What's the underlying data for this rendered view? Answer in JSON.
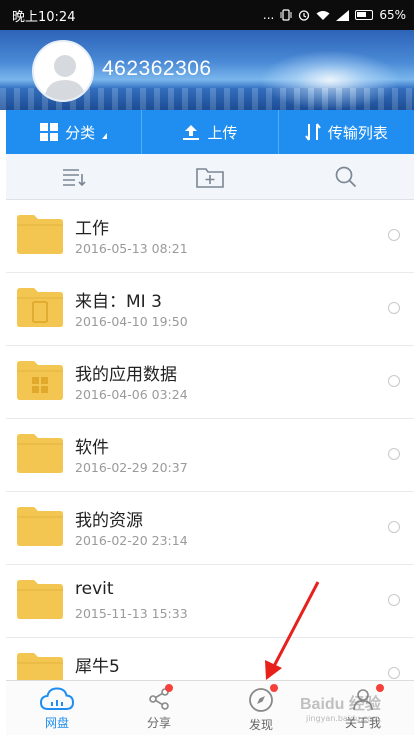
{
  "status_bar": {
    "time": "晚上10:24",
    "signal_dots": "...",
    "battery": "65%"
  },
  "profile": {
    "username": "462362306"
  },
  "actions": {
    "category": "分类",
    "upload": "上传",
    "transfer_list": "传输列表"
  },
  "files": [
    {
      "name": "工作",
      "date": "2016-05-13  08:21",
      "icon": "folder"
    },
    {
      "name": "来自：MI 3",
      "date": "2016-04-10  19:50",
      "icon": "folder-phone"
    },
    {
      "name": "我的应用数据",
      "date": "2016-04-06  03:24",
      "icon": "folder-apps"
    },
    {
      "name": "软件",
      "date": "2016-02-29  20:37",
      "icon": "folder"
    },
    {
      "name": "我的资源",
      "date": "2016-02-20  23:14",
      "icon": "folder"
    },
    {
      "name": "revit",
      "date": "2015-11-13  15:33",
      "icon": "folder"
    },
    {
      "name": "犀牛5",
      "date": "",
      "icon": "folder"
    }
  ],
  "bottom_nav": {
    "items": [
      {
        "label": "网盘",
        "icon": "cloud-icon",
        "active": true,
        "badge": false
      },
      {
        "label": "分享",
        "icon": "share-icon",
        "active": false,
        "badge": true
      },
      {
        "label": "发现",
        "icon": "compass-icon",
        "active": false,
        "badge": true
      },
      {
        "label": "关于我",
        "icon": "user-icon",
        "active": false,
        "badge": true
      }
    ]
  },
  "watermark": {
    "main": "Baidu 经验",
    "sub": "jingyan.baidu.com"
  },
  "colors": {
    "accent": "#1f8ef0",
    "folder": "#f3c551",
    "badge": "#f5413c"
  }
}
